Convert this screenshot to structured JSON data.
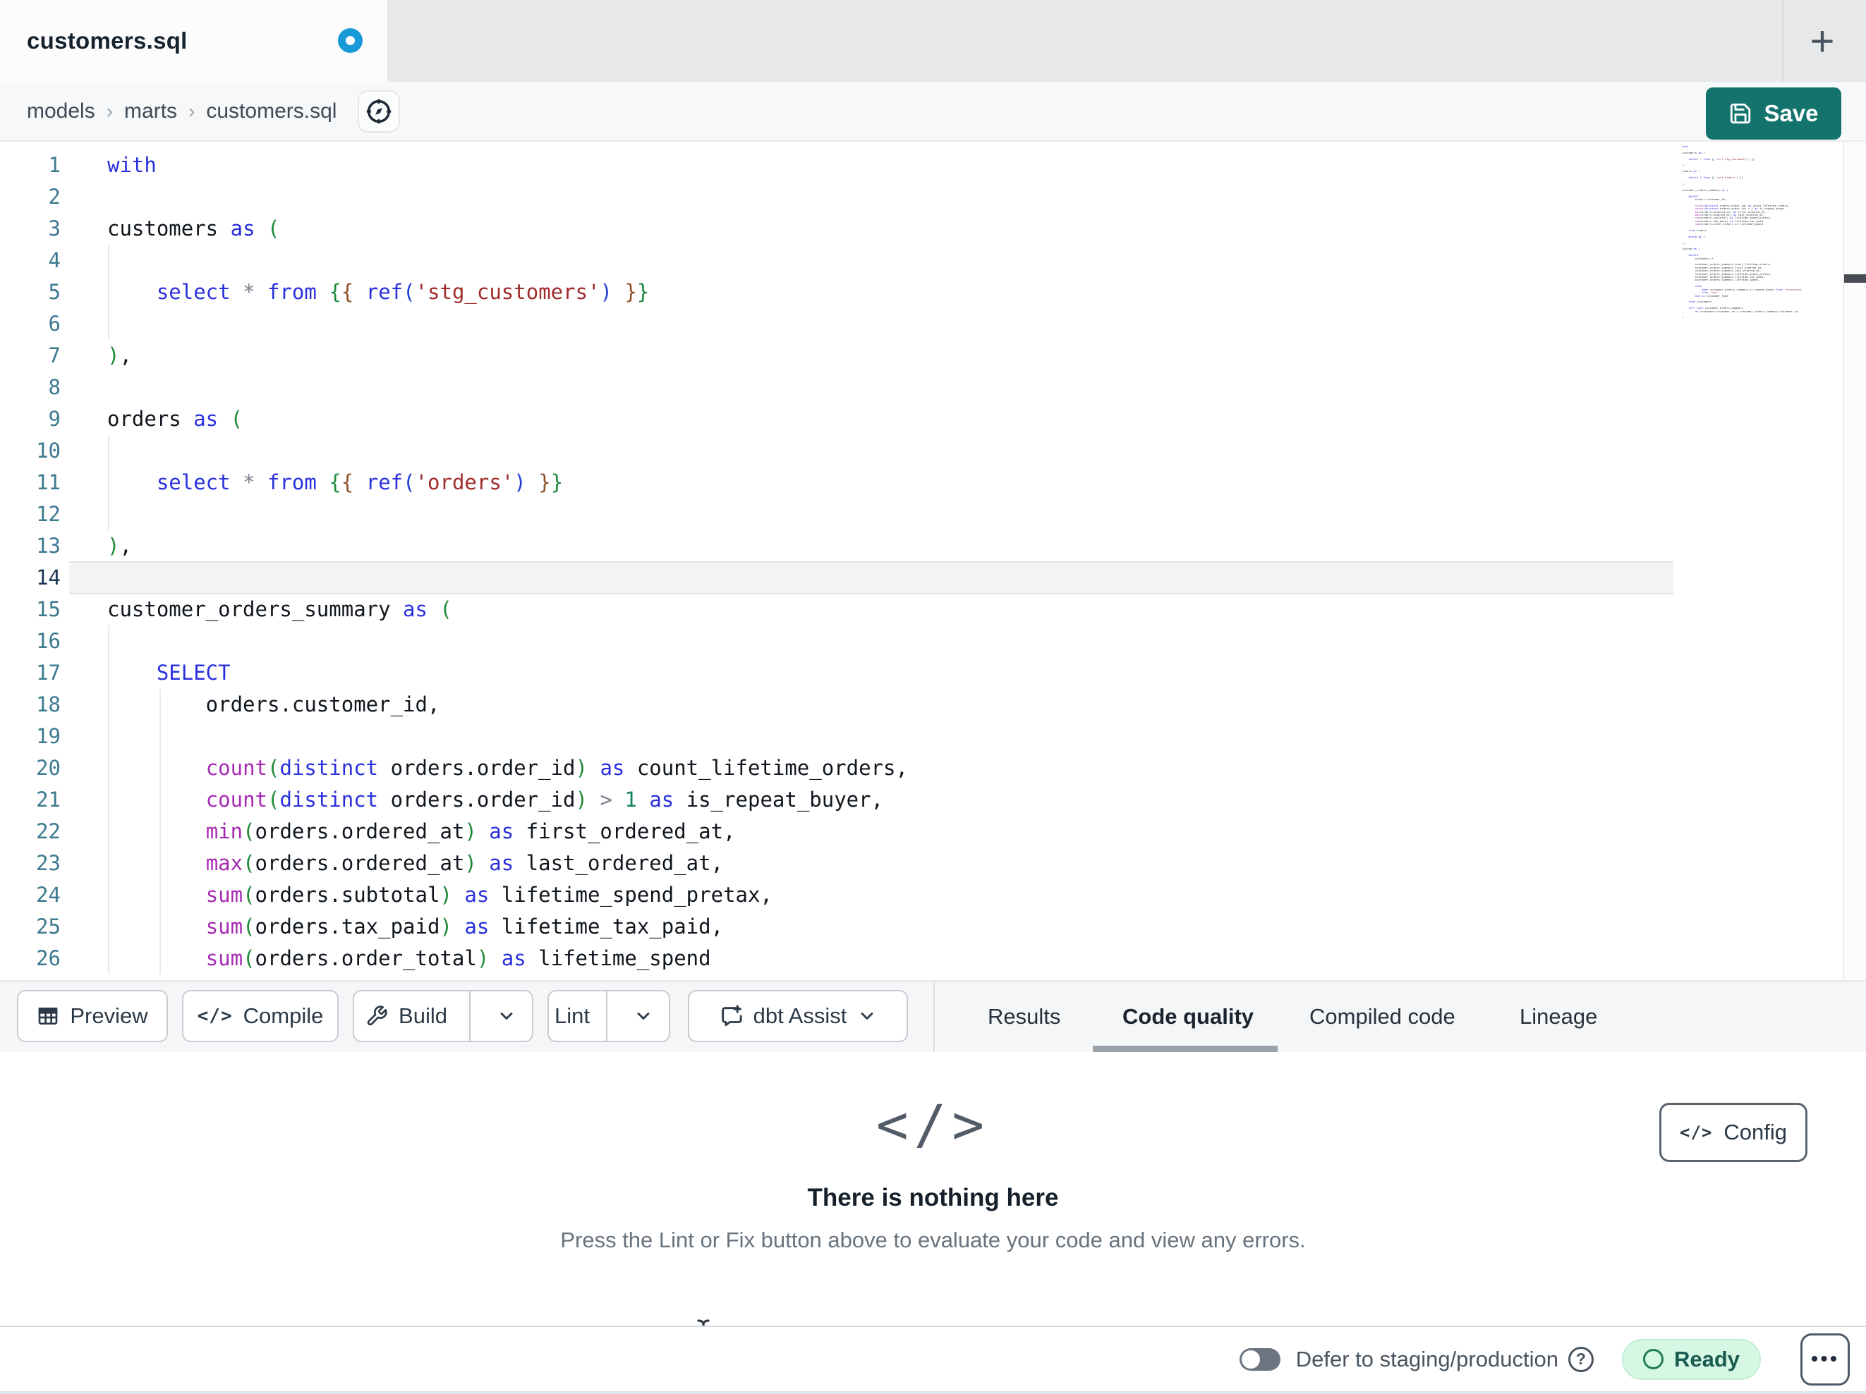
{
  "tab_bar": {
    "active_tab": "customers.sql",
    "new_tab_icon": "+"
  },
  "breadcrumb": {
    "items": [
      "models",
      "marts",
      "customers.sql"
    ],
    "separator": "›"
  },
  "header": {
    "save_label": "Save"
  },
  "editor": {
    "active_line": 14,
    "lines": [
      {
        "n": 1,
        "t": [
          [
            "kw",
            "with"
          ]
        ]
      },
      {
        "n": 2,
        "t": []
      },
      {
        "n": 3,
        "t": [
          [
            "pl",
            "customers "
          ],
          [
            "kw",
            "as"
          ],
          [
            "pl",
            " "
          ],
          [
            "b1",
            "("
          ]
        ]
      },
      {
        "n": 4,
        "t": []
      },
      {
        "n": 5,
        "t": [
          [
            "pl",
            "    "
          ],
          [
            "kw",
            "select"
          ],
          [
            "pl",
            " "
          ],
          [
            "op",
            "*"
          ],
          [
            "pl",
            " "
          ],
          [
            "kw",
            "from"
          ],
          [
            "pl",
            " "
          ],
          [
            "b1",
            "{"
          ],
          [
            "b2",
            "{"
          ],
          [
            "pl",
            " "
          ],
          [
            "kw",
            "ref"
          ],
          [
            "b3",
            "("
          ],
          [
            "str",
            "'stg_customers'"
          ],
          [
            "b3",
            ")"
          ],
          [
            "pl",
            " "
          ],
          [
            "b2",
            "}"
          ],
          [
            "b1",
            "}"
          ]
        ]
      },
      {
        "n": 6,
        "t": []
      },
      {
        "n": 7,
        "t": [
          [
            "b1",
            ")"
          ],
          [
            "pl",
            ","
          ]
        ]
      },
      {
        "n": 8,
        "t": []
      },
      {
        "n": 9,
        "t": [
          [
            "pl",
            "orders "
          ],
          [
            "kw",
            "as"
          ],
          [
            "pl",
            " "
          ],
          [
            "b1",
            "("
          ]
        ]
      },
      {
        "n": 10,
        "t": []
      },
      {
        "n": 11,
        "t": [
          [
            "pl",
            "    "
          ],
          [
            "kw",
            "select"
          ],
          [
            "pl",
            " "
          ],
          [
            "op",
            "*"
          ],
          [
            "pl",
            " "
          ],
          [
            "kw",
            "from"
          ],
          [
            "pl",
            " "
          ],
          [
            "b1",
            "{"
          ],
          [
            "b2",
            "{"
          ],
          [
            "pl",
            " "
          ],
          [
            "kw",
            "ref"
          ],
          [
            "b3",
            "("
          ],
          [
            "str",
            "'orders'"
          ],
          [
            "b3",
            ")"
          ],
          [
            "pl",
            " "
          ],
          [
            "b2",
            "}"
          ],
          [
            "b1",
            "}"
          ]
        ]
      },
      {
        "n": 12,
        "t": []
      },
      {
        "n": 13,
        "t": [
          [
            "b1",
            ")"
          ],
          [
            "pl",
            ","
          ]
        ]
      },
      {
        "n": 14,
        "t": []
      },
      {
        "n": 15,
        "t": [
          [
            "pl",
            "customer_orders_summary "
          ],
          [
            "kw",
            "as"
          ],
          [
            "pl",
            " "
          ],
          [
            "b1",
            "("
          ]
        ]
      },
      {
        "n": 16,
        "t": []
      },
      {
        "n": 17,
        "t": [
          [
            "pl",
            "    "
          ],
          [
            "kw",
            "SELECT"
          ]
        ]
      },
      {
        "n": 18,
        "t": [
          [
            "pl",
            "        orders.customer_id,"
          ]
        ]
      },
      {
        "n": 19,
        "t": []
      },
      {
        "n": 20,
        "t": [
          [
            "pl",
            "        "
          ],
          [
            "fn",
            "count"
          ],
          [
            "b1",
            "("
          ],
          [
            "kw",
            "distinct"
          ],
          [
            "pl",
            " orders.order_id"
          ],
          [
            "b1",
            ")"
          ],
          [
            "pl",
            " "
          ],
          [
            "kw",
            "as"
          ],
          [
            "pl",
            " count_lifetime_orders,"
          ]
        ]
      },
      {
        "n": 21,
        "t": [
          [
            "pl",
            "        "
          ],
          [
            "fn",
            "count"
          ],
          [
            "b1",
            "("
          ],
          [
            "kw",
            "distinct"
          ],
          [
            "pl",
            " orders.order_id"
          ],
          [
            "b1",
            ")"
          ],
          [
            "pl",
            " "
          ],
          [
            "op",
            ">"
          ],
          [
            "pl",
            " "
          ],
          [
            "num",
            "1"
          ],
          [
            "pl",
            " "
          ],
          [
            "kw",
            "as"
          ],
          [
            "pl",
            " is_repeat_buyer,"
          ]
        ]
      },
      {
        "n": 22,
        "t": [
          [
            "pl",
            "        "
          ],
          [
            "fn",
            "min"
          ],
          [
            "b1",
            "("
          ],
          [
            "pl",
            "orders.ordered_at"
          ],
          [
            "b1",
            ")"
          ],
          [
            "pl",
            " "
          ],
          [
            "kw",
            "as"
          ],
          [
            "pl",
            " first_ordered_at,"
          ]
        ]
      },
      {
        "n": 23,
        "t": [
          [
            "pl",
            "        "
          ],
          [
            "fn",
            "max"
          ],
          [
            "b1",
            "("
          ],
          [
            "pl",
            "orders.ordered_at"
          ],
          [
            "b1",
            ")"
          ],
          [
            "pl",
            " "
          ],
          [
            "kw",
            "as"
          ],
          [
            "pl",
            " last_ordered_at,"
          ]
        ]
      },
      {
        "n": 24,
        "t": [
          [
            "pl",
            "        "
          ],
          [
            "fn",
            "sum"
          ],
          [
            "b1",
            "("
          ],
          [
            "pl",
            "orders.subtotal"
          ],
          [
            "b1",
            ")"
          ],
          [
            "pl",
            " "
          ],
          [
            "kw",
            "as"
          ],
          [
            "pl",
            " lifetime_spend_pretax,"
          ]
        ]
      },
      {
        "n": 25,
        "t": [
          [
            "pl",
            "        "
          ],
          [
            "fn",
            "sum"
          ],
          [
            "b1",
            "("
          ],
          [
            "pl",
            "orders.tax_paid"
          ],
          [
            "b1",
            ")"
          ],
          [
            "pl",
            " "
          ],
          [
            "kw",
            "as"
          ],
          [
            "pl",
            " lifetime_tax_paid,"
          ]
        ]
      },
      {
        "n": 26,
        "t": [
          [
            "pl",
            "        "
          ],
          [
            "fn",
            "sum"
          ],
          [
            "b1",
            "("
          ],
          [
            "pl",
            "orders.order_total"
          ],
          [
            "b1",
            ")"
          ],
          [
            "pl",
            " "
          ],
          [
            "kw",
            "as"
          ],
          [
            "pl",
            " lifetime_spend"
          ]
        ]
      }
    ]
  },
  "minimap": {
    "lines": [
      "with",
      "",
      "customers as (",
      "",
      "    select * from {{ ref('stg_customers') }}",
      "",
      "),",
      "",
      "orders as (",
      "",
      "    select * from {{ ref('orders') }}",
      "",
      "),",
      "",
      "customer_orders_summary as (",
      "",
      "    SELECT",
      "        orders.customer_id,",
      "",
      "        count(distinct orders.order_id) as count_lifetime_orders,",
      "        count(distinct orders.order_id) > 1 as is_repeat_buyer,",
      "        min(orders.ordered_at) as first_ordered_at,",
      "        max(orders.ordered_at) as last_ordered_at,",
      "        sum(orders.subtotal) as lifetime_spend_pretax,",
      "        sum(orders.tax_paid) as lifetime_tax_paid,",
      "        sum(orders.order_total) as lifetime_spend",
      "",
      "    from orders",
      "",
      "    group by 1",
      "",
      "),",
      "",
      "joined as (",
      "",
      "    select",
      "        customers.*,",
      "",
      "        customer_orders_summary.count_lifetime_orders,",
      "        customer_orders_summary.first_ordered_at,",
      "        customer_orders_summary.last_ordered_at,",
      "        customer_orders_summary.lifetime_spend_pretax,",
      "        customer_orders_summary.lifetime_tax_paid,",
      "        customer_orders_summary.lifetime_spend,",
      "",
      "        case",
      "            when customer_orders_summary.is_repeat_buyer then 'returning'",
      "            else 'new'",
      "        end as customer_type",
      "",
      "    from customers",
      "",
      "    left join customer_orders_summary",
      "        on customers.customer_id = customer_orders_summary.customer_id",
      "",
      ")",
      "",
      "select * from joined"
    ]
  },
  "toolbar": {
    "preview_label": "Preview",
    "compile_label": "Compile",
    "build_label": "Build",
    "lint_label": "Lint",
    "assist_label": "dbt Assist",
    "compile_glyph": "</>"
  },
  "result_tabs": [
    {
      "label": "Results",
      "active": false
    },
    {
      "label": "Code quality",
      "active": true
    },
    {
      "label": "Compiled code",
      "active": false
    },
    {
      "label": "Lineage",
      "active": false
    }
  ],
  "panel": {
    "config_label": "Config",
    "config_glyph": "</>",
    "empty_icon": "</>",
    "empty_title": "There is nothing here",
    "empty_subtitle": "Press the Lint or Fix button above to evaluate your code and view any errors."
  },
  "status_bar": {
    "defer_label": "Defer to staging/production",
    "help_glyph": "?",
    "ready_label": "Ready",
    "menu_icon": "•••"
  },
  "colors": {
    "accent_teal": "#15736e",
    "dirty_dot_blue": "#189ad8",
    "ready_bg": "#d6f7e4",
    "ready_text": "#1a5b50",
    "ready_ring": "#1e7d52",
    "syntax": {
      "kw": "#2a30dd",
      "fn": "#a62bb2",
      "str": "#a02c2c",
      "b1": "#1f8a3b",
      "b2": "#8f4f2a",
      "b3": "#2440d9",
      "num": "#12835f",
      "op": "#7a828e",
      "pl": "#10161d",
      "line_num": "#3d7a90",
      "line_num_active": "#1d3557"
    }
  }
}
